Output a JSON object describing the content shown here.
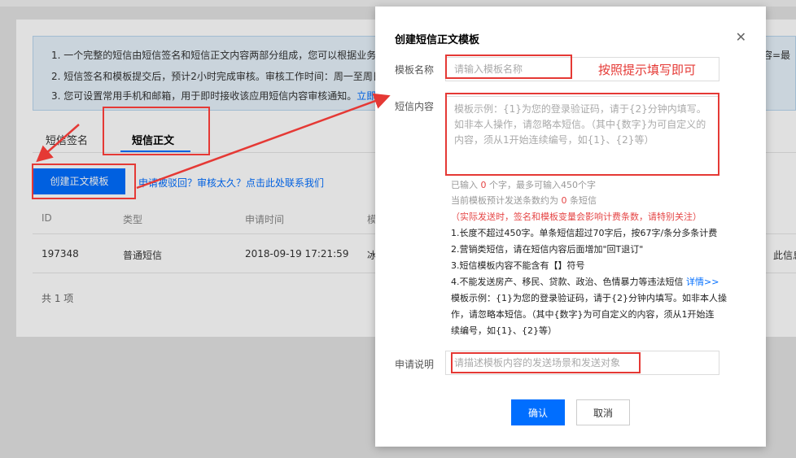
{
  "background": {
    "notice": {
      "line1": "1. 一个完整的短信由短信签名和短信正文内容两部分组成，您可以根据业务",
      "line1_tail": "内容=最",
      "line2": "2. 短信签名和模板提交后，预计2小时完成审核。审核工作时间：周一至周日",
      "line3": "3. 您可设置常用手机和邮箱，用于即时接收该应用短信内容审核通知。",
      "line3_link": "立即"
    },
    "tabs": [
      "短信签名",
      "短信正文"
    ],
    "create_button": "创建正文模板",
    "help_link": "申请被驳回？审核太久？点击此处联系我们",
    "table": {
      "headers": [
        "ID",
        "类型",
        "申请时间",
        "模"
      ],
      "row": [
        "197348",
        "普通短信",
        "2018-09-19 17:21:59",
        "冰"
      ],
      "row_tail": "此信息"
    },
    "total": "共 1 项"
  },
  "dialog": {
    "title": "创建短信正文模板",
    "close_icon": "close-icon",
    "fields": {
      "name_label": "模板名称",
      "name_placeholder": "请输入模板名称",
      "content_label": "短信内容",
      "content_placeholder": "模板示例：{1}为您的登录验证码，请于{2}分钟内填写。如非本人操作，请忽略本短信。（其中{数字}为可自定义的内容，须从1开始连续编号，如{1}、{2}等）",
      "desc_label": "申请说明",
      "desc_placeholder": "请描述模板内容的发送场景和发送对象"
    },
    "counter": {
      "prefix": "已输入",
      "count": "0",
      "suffix": "个字，最多可输入450个字"
    },
    "estimate": {
      "prefix": "当前模板预计发送条数约为",
      "count": "0",
      "suffix": "条短信"
    },
    "warning": "（实际发送时，签名和模板变量会影响计费条数，请特别关注）",
    "rules": [
      "1.长度不超过450字。单条短信超过70字后，按67字/条分多条计费",
      "2.营销类短信，请在短信内容后面增加\"回T退订\"",
      "3.短信模板内容不能含有【】符号",
      "4.不能发送房产、移民、贷款、政治、色情暴力等违法短信"
    ],
    "rules_link": "详情>>",
    "example_lines": [
      "模板示例：{1}为您的登录验证码，请于{2}分钟内填写。如非本人操",
      "作，请忽略本短信。（其中{数字}为可自定义的内容，须从1开始连",
      "续编号，如{1}、{2}等）"
    ],
    "ok_button": "确认",
    "cancel_button": "取消"
  },
  "annotation": {
    "text": "按照提示填写即可",
    "color": "#e53935"
  },
  "colors": {
    "primary": "#006eff",
    "danger": "#e54545"
  }
}
